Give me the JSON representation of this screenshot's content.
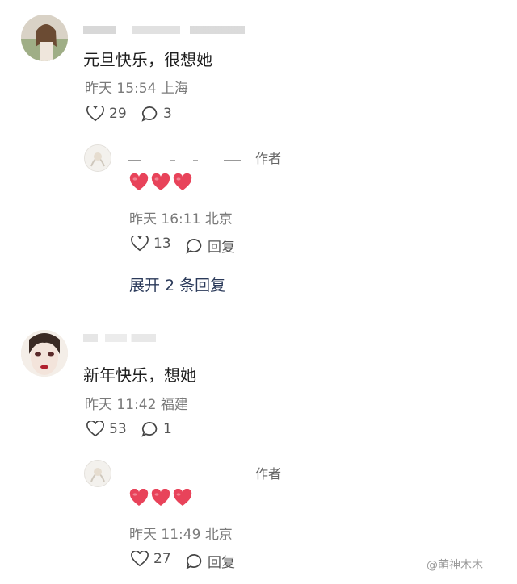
{
  "comments": [
    {
      "text": "元旦快乐，很想她",
      "time": "昨天 15:54",
      "location": "上海",
      "likes": "29",
      "replies": "3",
      "reply": {
        "badge": "作者",
        "time": "昨天 16:11",
        "location": "北京",
        "likes": "13",
        "reply_label": "回复"
      },
      "expand_label": "展开 2 条回复"
    },
    {
      "text": "新年快乐，想她",
      "time": "昨天 11:42",
      "location": "福建",
      "likes": "53",
      "replies": "1",
      "reply": {
        "badge": "作者",
        "time": "昨天 11:49",
        "location": "北京",
        "likes": "27",
        "reply_label": "回复"
      }
    }
  ],
  "watermark": "@萌神木木",
  "colors": {
    "heart": "#e8435a",
    "meta": "#7a7a7a",
    "link": "#2b3a5a"
  }
}
